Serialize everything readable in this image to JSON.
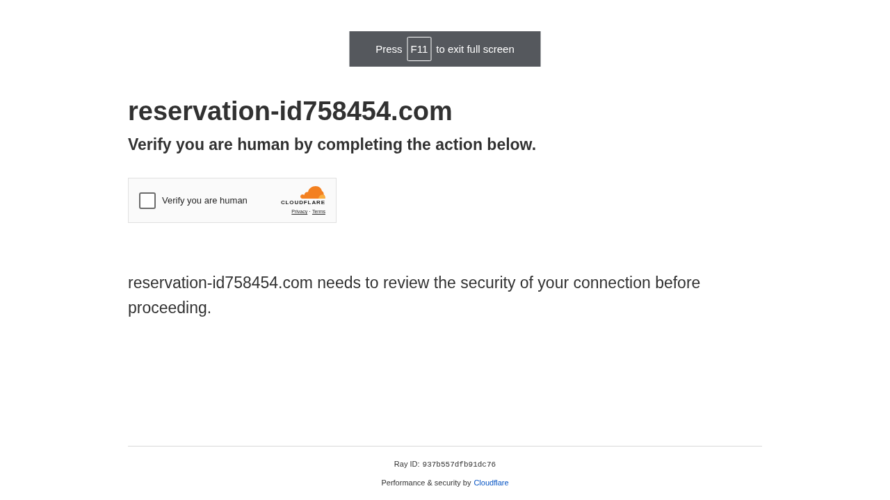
{
  "toast": {
    "before": "Press",
    "key": "F11",
    "after": "to exit full screen"
  },
  "heading": "reservation-id758454.com",
  "subheading": "Verify you are human by completing the action below.",
  "challenge": {
    "checkbox_label": "Verify you are human",
    "checked": false,
    "brand": "CLOUDFLARE",
    "links": [
      "Privacy",
      "Terms"
    ],
    "separator": "·"
  },
  "message": "reservation-id758454.com needs to review the security of your connection before proceeding.",
  "footer": {
    "ray_id_label": "Ray ID:",
    "ray_id": "937b557dfb91dc76",
    "credit": "Performance & security by",
    "credit_link": "Cloudflare"
  }
}
